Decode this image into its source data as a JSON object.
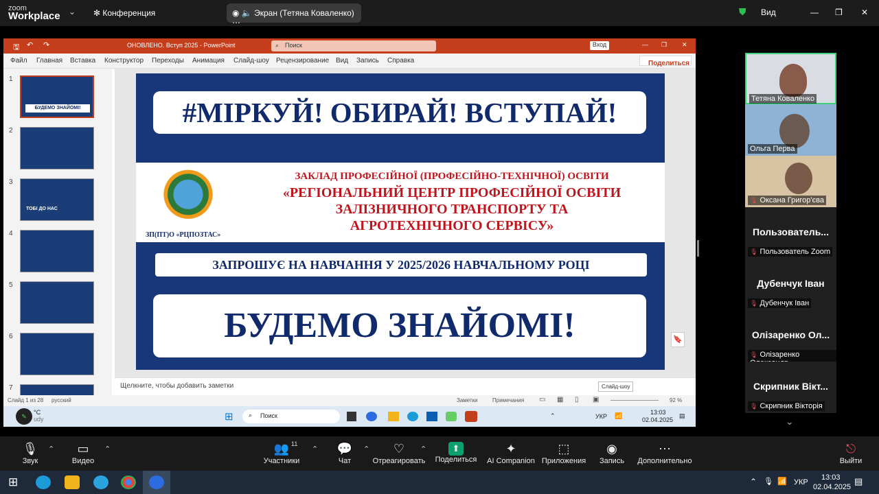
{
  "zoom_top": {
    "logo_small": "zoom",
    "logo_big": "Workplace",
    "meeting": "Конференция",
    "share_label": "Экран (Тетяна  Коваленко)",
    "view": "Вид"
  },
  "ppt": {
    "title": "ОНОВЛЕНО. Вступ 2025  -  PowerPoint",
    "search": "Поиск",
    "signin": "Вход",
    "tabs": [
      "Файл",
      "Главная",
      "Вставка",
      "Конструктор",
      "Переходы",
      "Анимация",
      "Слайд-шоу",
      "Рецензирование",
      "Вид",
      "Запись",
      "Справка"
    ],
    "share": "Поделиться",
    "slide_numbers": [
      "1",
      "2",
      "3",
      "4",
      "5",
      "6",
      "7"
    ],
    "notes": "Щелкните, чтобы добавить заметки",
    "status_left": "Слайд 1 из 28",
    "lang": "русский",
    "status_notes": "Заметки",
    "status_comments": "Примечания",
    "zoom_pct": "92 %",
    "tooltip": "Слайд-шоу"
  },
  "slide": {
    "line1": "#МІРКУЙ! ОБИРАЙ! ВСТУПАЙ!",
    "inst1": "ЗАКЛАД ПРОФЕСІЙНОЇ (ПРОФЕСІЙНО-ТЕХНІЧНОЇ) ОСВІТИ",
    "inst2": "«РЕГІОНАЛЬНИЙ ЦЕНТР ПРОФЕСІЙНОЇ ОСВІТИ",
    "inst3": "ЗАЛІЗНИЧНОГО ТРАНСПОРТУ ТА",
    "inst4": "АГРОТЕХНІЧНОГО СЕРВІСУ»",
    "abbr": "ЗП(ПТ)О «РЦПОЗТАС»",
    "invite": "ЗАПРОШУЄ НА НАВЧАННЯ У 2025/2026 НАВЧАЛЬНОМУ РОЦІ",
    "closing": "БУДЕМО ЗНАЙОМІ!"
  },
  "thumb_texts": {
    "t1": "БУДЕМО ЗНАЙОМІ!",
    "t3": "ТОБІ ДО НАС"
  },
  "shared_taskbar": {
    "search": "Поиск",
    "lang": "УКР",
    "time": "13:03",
    "date": "02.04.2025",
    "weather": "°C",
    "weather2": "udy"
  },
  "participants": [
    {
      "name": "Тетяна  Коваленко",
      "video": true
    },
    {
      "name": "Ольга Перва",
      "video": true
    },
    {
      "name": "Оксана Григор'єва",
      "video": true
    },
    {
      "title": "Пользователь...",
      "name": "Пользователь Zoom"
    },
    {
      "title": "Дубенчук Іван",
      "name": "Дубенчук Іван"
    },
    {
      "title": "Олізаренко Ол...",
      "name": "Олізаренко Олександр"
    },
    {
      "title": "Скрипник Вікт...",
      "name": "Скрипник Вікторія"
    }
  ],
  "zoom_bar": {
    "audio": "Звук",
    "video": "Видео",
    "participants": "Участники",
    "participants_count": "11",
    "chat": "Чат",
    "react": "Отреагировать",
    "share": "Поделиться",
    "ai": "AI Companion",
    "apps": "Приложения",
    "record": "Запись",
    "more": "Дополнительно",
    "leave": "Выйти"
  },
  "win": {
    "lang": "УКР",
    "time": "13:03",
    "date": "02.04.2025"
  },
  "colors": {
    "ppt_red": "#c43e1c",
    "slide_blue": "#17377a",
    "slide_text": "#112a6b",
    "inst_red": "#c0141c",
    "zoom_share": "#0e9f6e"
  }
}
